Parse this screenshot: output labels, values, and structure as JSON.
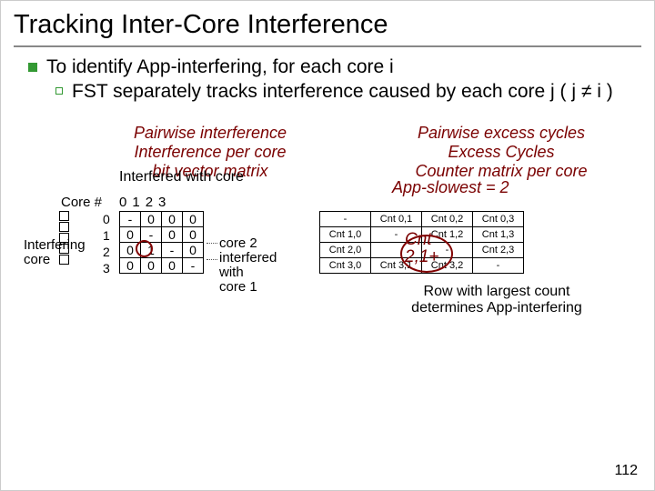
{
  "title": "Tracking Inter-Core Interference",
  "bullet1": "To identify App-interfering, for each core i",
  "bullet2": "FST separately tracks interference caused by each core j ( j ≠ i )",
  "leftLabel": "Pairwise interference\nInterference per core\nbit vector matrix",
  "rightLabel": "Pairwise excess cycles\nExcess Cycles\nCounter matrix per core",
  "interferedCaption": "Interfered with core",
  "coreHeaderPrefix": "Core #",
  "colHeaders": [
    "0",
    "1",
    "2",
    "3"
  ],
  "rowIds": [
    "0",
    "1",
    "2",
    "3"
  ],
  "interferingLabel": "Interfering\ncore",
  "matrix": {
    "r0": [
      "-",
      "0",
      "0",
      "0"
    ],
    "r1": [
      "0",
      "-",
      "0",
      "0"
    ],
    "r2": [
      "0",
      "1",
      "-",
      "0"
    ],
    "r3": [
      "0",
      "0",
      "0",
      "-"
    ]
  },
  "annotation": "core 2\ninterfered\nwith\ncore 1",
  "appSlowest": "App-slowest = 2",
  "cntBig": "Cnt\n2,1+",
  "counter": {
    "r0": [
      "-",
      "Cnt 0,1",
      "Cnt 0,2",
      "Cnt 0,3"
    ],
    "r1": [
      "Cnt 1,0",
      "-",
      "Cnt 1,2",
      "Cnt 1,3"
    ],
    "r2": [
      "Cnt 2,0",
      "",
      "-",
      "Cnt 2,3"
    ],
    "r3": [
      "Cnt 3,0",
      "Cnt 3,1",
      "Cnt 3,2",
      "-"
    ]
  },
  "rowCaption": "Row with largest count\ndetermines App-interfering",
  "pageNum": "112",
  "chart_data": [
    {
      "type": "table",
      "title": "Pairwise interference bit matrix",
      "categories": [
        "0",
        "1",
        "2",
        "3"
      ],
      "series": [
        {
          "name": "0",
          "values": [
            "-",
            0,
            0,
            0
          ]
        },
        {
          "name": "1",
          "values": [
            0,
            "-",
            0,
            0
          ]
        },
        {
          "name": "2",
          "values": [
            0,
            1,
            "-",
            0
          ]
        },
        {
          "name": "3",
          "values": [
            0,
            0,
            0,
            "-"
          ]
        }
      ]
    },
    {
      "type": "table",
      "title": "Pairwise excess cycles counter matrix",
      "categories": [
        "0",
        "1",
        "2",
        "3"
      ],
      "series": [
        {
          "name": "0",
          "values": [
            "-",
            "Cnt 0,1",
            "Cnt 0,2",
            "Cnt 0,3"
          ]
        },
        {
          "name": "1",
          "values": [
            "Cnt 1,0",
            "-",
            "Cnt 1,2",
            "Cnt 1,3"
          ]
        },
        {
          "name": "2",
          "values": [
            "Cnt 2,0",
            "Cnt 2,1+",
            "-",
            "Cnt 2,3"
          ]
        },
        {
          "name": "3",
          "values": [
            "Cnt 3,0",
            "Cnt 3,1",
            "Cnt 3,2",
            "-"
          ]
        }
      ]
    }
  ]
}
